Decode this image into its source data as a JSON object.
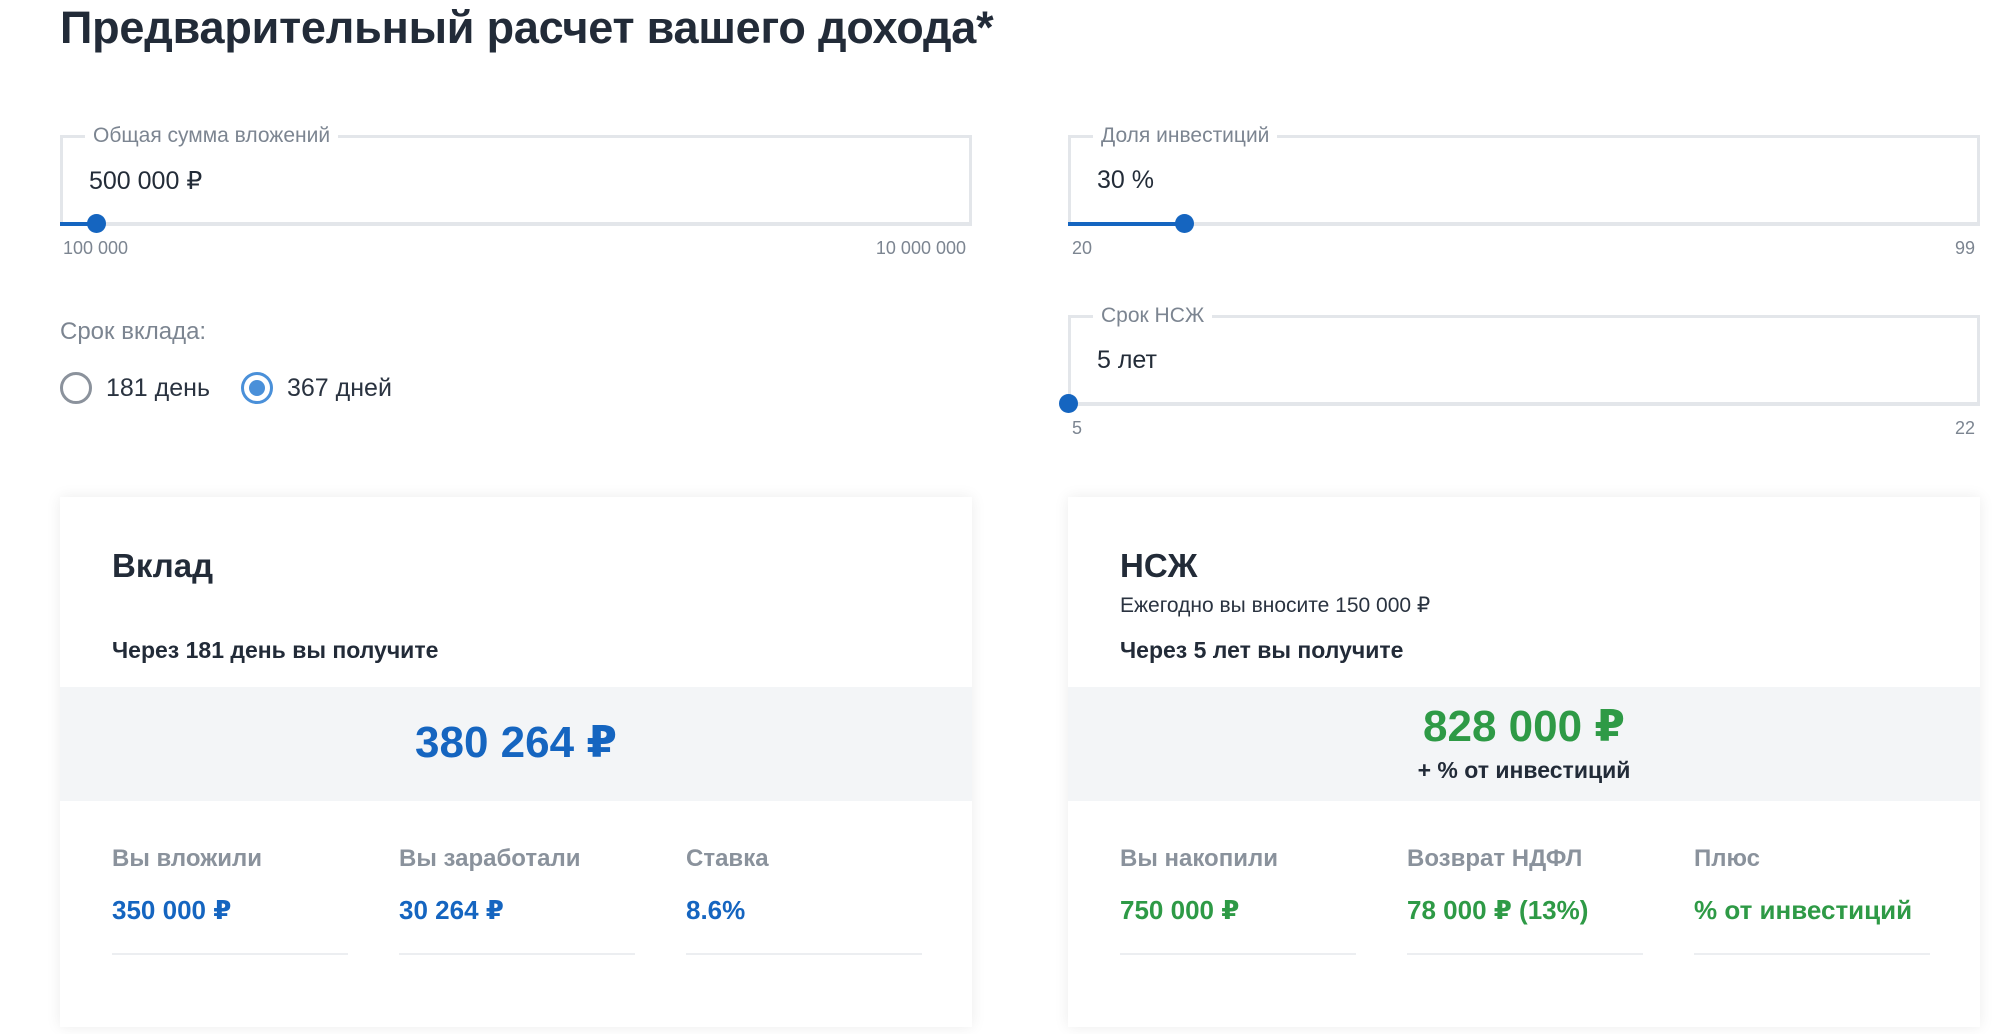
{
  "page": {
    "title": "Предварительный расчет вашего дохода*"
  },
  "calculator": {
    "total_amount": {
      "label": "Общая сумма вложений",
      "value": "500 000  ₽",
      "min": "100 000",
      "max": "10 000 000",
      "position_fraction": 0.04
    },
    "investment_share": {
      "label": "Доля инвестиций",
      "value": "30 %",
      "min": "20",
      "max": "99",
      "position_fraction": 0.127
    },
    "term_nszh": {
      "label": "Срок НСЖ",
      "value": "5  лет",
      "min": "5",
      "max": "22",
      "position_fraction": 0.0
    },
    "deposit_term": {
      "label": "Срок вклада:",
      "options": [
        {
          "label": "181 день",
          "checked": false
        },
        {
          "label": "367 дней",
          "checked": true
        }
      ]
    }
  },
  "deposit_card": {
    "title": "Вклад",
    "receive_text": "Через 181 день вы получите",
    "amount": "380 264 ₽",
    "stats": [
      {
        "label": "Вы вложили",
        "value": "350 000 ₽"
      },
      {
        "label": "Вы заработали",
        "value": "30 264 ₽"
      },
      {
        "label": "Ставка",
        "value": "8.6%"
      }
    ]
  },
  "nszh_card": {
    "title": "НСЖ",
    "subtitle": "Ежегодно вы вносите 150 000 ₽",
    "receive_text": "Через 5 лет вы получите",
    "amount": "828 000 ₽",
    "amount_note": "+ % от инвестиций",
    "stats": [
      {
        "label": "Вы накопили",
        "value": "750 000 ₽"
      },
      {
        "label": "Возврат НДФЛ",
        "value": "78 000 ₽ (13%)"
      },
      {
        "label": "Плюс",
        "value": "% от инвестиций"
      }
    ]
  },
  "colors": {
    "accent_blue": "#1565c0",
    "accent_green": "#2e9a46",
    "muted_text": "#7c8591",
    "band_bg": "#f3f5f7"
  }
}
